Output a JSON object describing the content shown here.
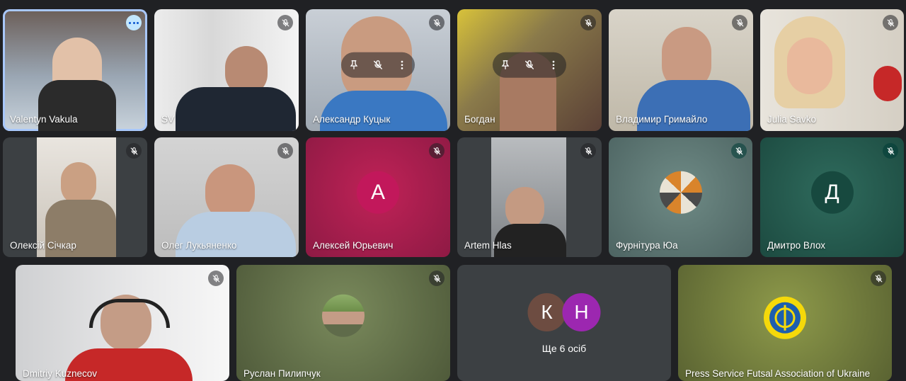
{
  "participants": [
    {
      "name": "Valentyn Vakula"
    },
    {
      "name": "SV"
    },
    {
      "name": "Александр Куцык"
    },
    {
      "name": "Богдан"
    },
    {
      "name": "Владимир Гримайло"
    },
    {
      "name": "Julia Savko"
    },
    {
      "name": "Олексій Січкар"
    },
    {
      "name": "Олег Лукьяненко"
    },
    {
      "name": "Алексей Юрьевич",
      "initial": "А"
    },
    {
      "name": "Artem Hlas"
    },
    {
      "name": "Фурнітура Юа"
    },
    {
      "name": "Дмитро Влох",
      "initial": "Д"
    },
    {
      "name": "Dmitriy Kuznecov"
    },
    {
      "name": "Руслан Пилипчук"
    },
    {
      "name": "Press Service Futsal Association of Ukraine"
    }
  ],
  "others": {
    "initials": [
      "К",
      "Н"
    ],
    "label": "Ще 6 осіб"
  },
  "colors": {
    "background": "#202124",
    "active_border": "#a8c7fa",
    "avatar_red": "#c2185b",
    "avatar_k": "#6d4c41",
    "avatar_n": "#9c27b0"
  }
}
